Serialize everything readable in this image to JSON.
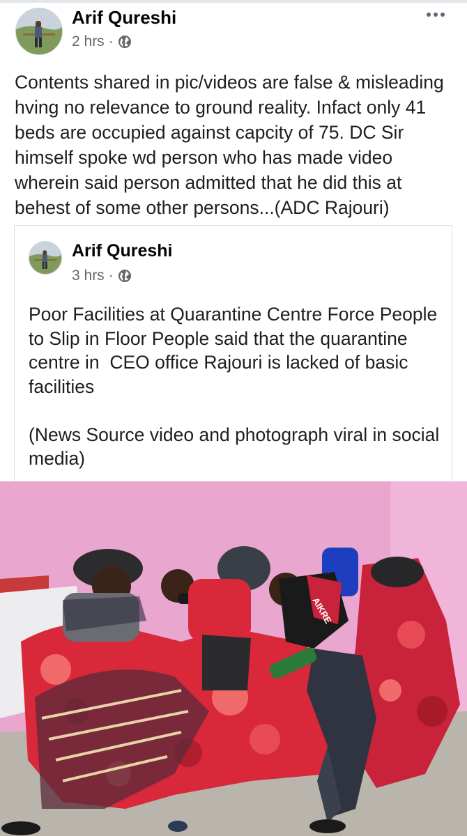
{
  "post": {
    "author": "Arif Qureshi",
    "time": "2 hrs",
    "separator": "·",
    "text": "Contents shared in pic/videos are false & misleading hving no relevance to ground reality. Infact only 41 beds are occupied against capcity of 75. DC Sir himself spoke wd person who has made video wherein said person admitted that he did this at behest of some other persons...(ADC Rajouri)",
    "audience_icon": "globe-icon",
    "menu_icon": "more-options-icon"
  },
  "shared_post": {
    "author": "Arif Qureshi",
    "time": "3 hrs",
    "separator": "·",
    "audience_icon": "globe-icon",
    "text": "Poor Facilities at Quarantine Centre Force People to Slip in Floor People said that the quarantine centre in  CEO office Rajouri is lacked of basic facilities\n\n(News Source video and photograph viral in social media)",
    "photo_caption_visible": "AIKRE"
  },
  "colors": {
    "name": "#050505",
    "meta": "#65676b",
    "text": "#1c1e21",
    "wall": "#e9a6cf",
    "blanket_red": "#d8283a"
  }
}
